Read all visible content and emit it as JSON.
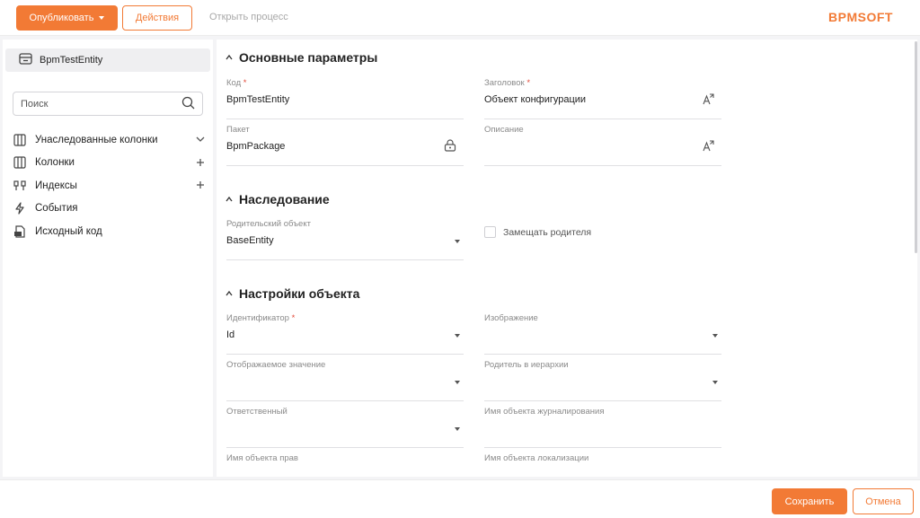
{
  "toolbar": {
    "publish_label": "Опубликовать",
    "actions_label": "Действия",
    "open_process_label": "Открыть процесс",
    "logo_text": "BPMSOFT"
  },
  "sidebar": {
    "entity_name": "BpmTestEntity",
    "search_placeholder": "Поиск",
    "items": [
      {
        "label": "Унаследованные колонки",
        "icon": "columns-icon",
        "action": "chevron-down-icon"
      },
      {
        "label": "Колонки",
        "icon": "columns-icon",
        "action": "plus-icon"
      },
      {
        "label": "Индексы",
        "icon": "index-icon",
        "action": "plus-icon"
      },
      {
        "label": "События",
        "icon": "lightning-icon",
        "action": ""
      },
      {
        "label": "Исходный код",
        "icon": "source-code-icon",
        "action": ""
      }
    ]
  },
  "main": {
    "sections": {
      "basic": "Основные параметры",
      "inheritance": "Наследование",
      "object_settings": "Настройки объекта"
    },
    "fields": {
      "code": {
        "label": "Код",
        "required": "*",
        "value": "BpmTestEntity"
      },
      "title": {
        "label": "Заголовок",
        "required": "*",
        "value": "Объект конфигурации"
      },
      "package": {
        "label": "Пакет",
        "value": "BpmPackage"
      },
      "description": {
        "label": "Описание",
        "value": ""
      },
      "parent_object": {
        "label": "Родительский объект",
        "value": "BaseEntity"
      },
      "replace_parent": {
        "label": "Замещать родителя",
        "checked": false
      },
      "identifier": {
        "label": "Идентификатор",
        "required": "*",
        "value": "Id"
      },
      "image": {
        "label": "Изображение",
        "value": ""
      },
      "display_value": {
        "label": "Отображаемое значение",
        "value": ""
      },
      "hierarchy_parent": {
        "label": "Родитель в иерархии",
        "value": ""
      },
      "owner": {
        "label": "Ответственный",
        "value": ""
      },
      "journal_object": {
        "label": "Имя объекта журналирования",
        "value": ""
      },
      "rights_object": {
        "label": "Имя объекта прав",
        "value": ""
      },
      "localization_object": {
        "label": "Имя объекта локализации",
        "value": ""
      }
    }
  },
  "footer": {
    "save_label": "Сохранить",
    "cancel_label": "Отмена"
  },
  "colors": {
    "accent": "#f27a35",
    "required": "#e34b3a"
  }
}
